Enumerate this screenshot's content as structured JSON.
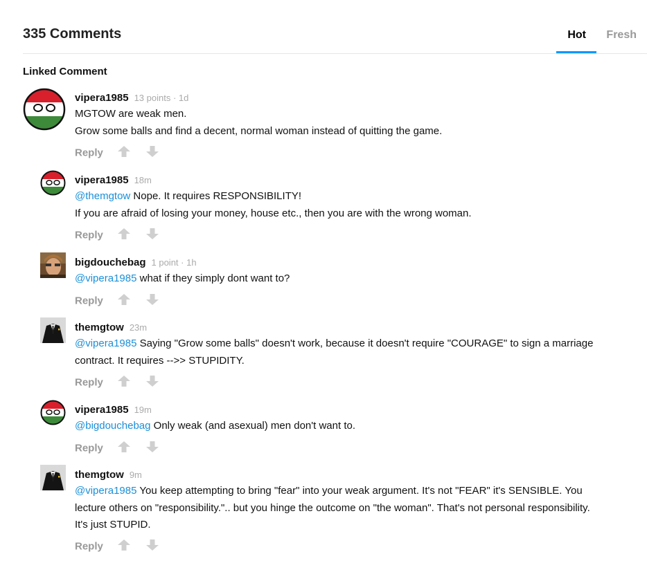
{
  "header": {
    "count_title": "335 Comments",
    "tabs": [
      {
        "label": "Hot",
        "active": true
      },
      {
        "label": "Fresh",
        "active": false
      }
    ],
    "accent_color": "#0099ff"
  },
  "linked_label": "Linked Comment",
  "comments": [
    {
      "username": "vipera1985",
      "meta": "13 points · 1d",
      "avatar": "hungary-ball-avatar",
      "lines": [
        {
          "text": "MGTOW are weak men."
        },
        {
          "text": "Grow some balls and find a decent, normal woman instead of quitting the game."
        }
      ],
      "reply_label": "Reply"
    },
    {
      "username": "vipera1985",
      "meta": "18m",
      "avatar": "hungary-ball-avatar",
      "mention": "@themgtow",
      "lines": [
        {
          "text": " Nope. It requires RESPONSIBILITY!"
        },
        {
          "text": "If you are afraid of losing your money, house etc., then you are with the wrong woman."
        }
      ],
      "reply_label": "Reply"
    },
    {
      "username": "bigdouchebag",
      "meta": "1 point · 1h",
      "avatar": "photo-avatar",
      "mention": "@vipera1985",
      "lines": [
        {
          "text": " what if they simply dont want to?"
        }
      ],
      "reply_label": "Reply"
    },
    {
      "username": "themgtow",
      "meta": "23m",
      "avatar": "suit-avatar",
      "mention": "@vipera1985",
      "lines": [
        {
          "text": " Saying \"Grow some balls\" doesn't work, because it doesn't require \"COURAGE\" to sign a marriage"
        },
        {
          "text": "contract. It requires -->> STUPIDITY."
        }
      ],
      "reply_label": "Reply"
    },
    {
      "username": "vipera1985",
      "meta": "19m",
      "avatar": "hungary-ball-avatar",
      "mention": "@bigdouchebag",
      "lines": [
        {
          "text": " Only weak (and asexual) men don't want to."
        }
      ],
      "reply_label": "Reply"
    },
    {
      "username": "themgtow",
      "meta": "9m",
      "avatar": "suit-avatar",
      "mention": "@vipera1985",
      "lines": [
        {
          "text": " You keep attempting to bring \"fear\" into your weak argument. It's not \"FEAR\" it's SENSIBLE. You"
        },
        {
          "text": "lecture others on \"responsibility.\".. but you hinge the outcome on \"the woman\". That's not personal responsibility."
        },
        {
          "text": "It's just STUPID."
        }
      ],
      "reply_label": "Reply"
    }
  ]
}
